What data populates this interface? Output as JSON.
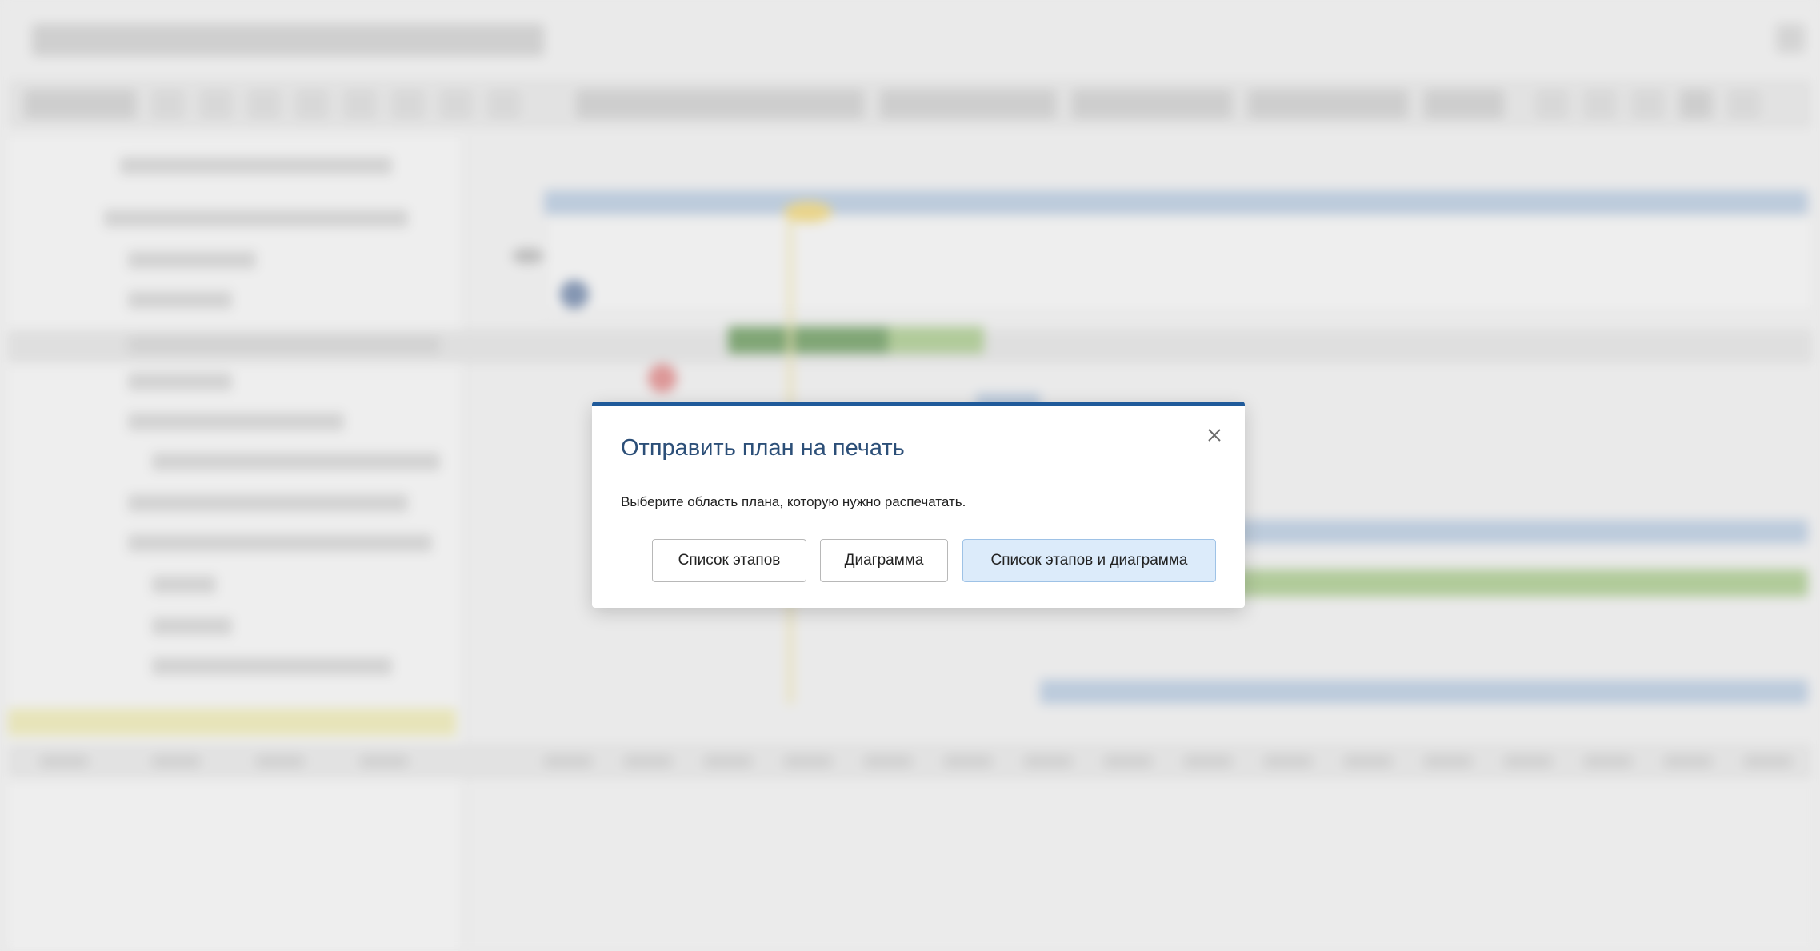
{
  "dialog": {
    "title": "Отправить план на печать",
    "message": "Выберите область плана, которую нужно распечатать.",
    "buttons": {
      "stages": "Список этапов",
      "chart": "Диаграмма",
      "both": "Список этапов и диаграмма"
    },
    "accent_color": "#1f5a9a",
    "close_icon": "close-icon"
  }
}
